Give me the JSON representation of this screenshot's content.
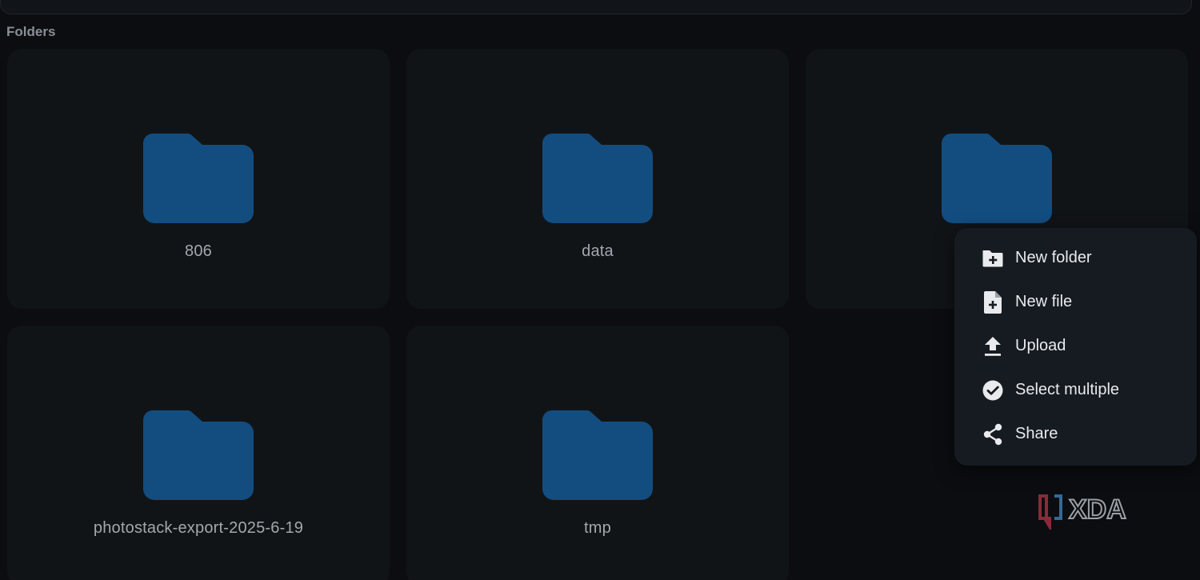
{
  "section": {
    "title": "Folders"
  },
  "folders": [
    {
      "name": "806",
      "icon": "folder-icon"
    },
    {
      "name": "data",
      "icon": "folder-icon"
    },
    {
      "name": "",
      "icon": "folder-icon"
    },
    {
      "name": "photostack-export-2025-6-19",
      "icon": "folder-icon"
    },
    {
      "name": "tmp",
      "icon": "folder-icon"
    }
  ],
  "context_menu": {
    "items": [
      {
        "label": "New folder",
        "icon": "new-folder-icon"
      },
      {
        "label": "New file",
        "icon": "new-file-icon"
      },
      {
        "label": "Upload",
        "icon": "upload-icon"
      },
      {
        "label": "Select multiple",
        "icon": "check-circle-icon"
      },
      {
        "label": "Share",
        "icon": "share-icon"
      }
    ]
  },
  "watermark": {
    "brand": "XDA"
  },
  "colors": {
    "background": "#0b0d10",
    "card": "#111417",
    "folder": "#134d80",
    "menu": "#161b21",
    "menu_text": "#e8eaed",
    "folder_text": "#a3a8ae"
  }
}
